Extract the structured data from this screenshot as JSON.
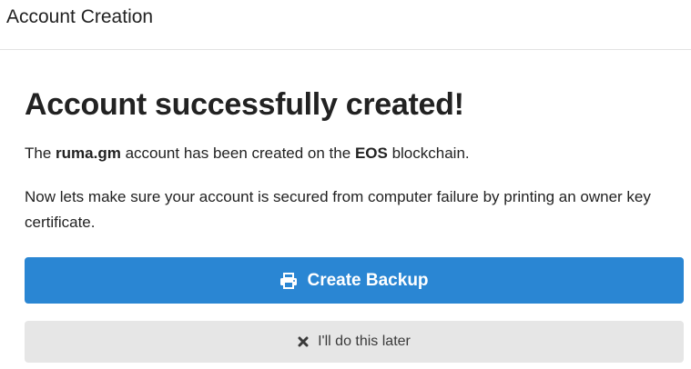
{
  "header": {
    "title": "Account Creation"
  },
  "main": {
    "headline": "Account successfully created!",
    "message": {
      "prefix": "The",
      "account_name": "ruma.gm",
      "middle": "account has been created on the",
      "chain": "EOS",
      "suffix": "blockchain."
    },
    "advice": "Now lets make sure your account is secured from computer failure by printing an owner key certificate."
  },
  "buttons": {
    "create_backup": {
      "label": "Create Backup",
      "icon": "printer-icon",
      "color": "#2a86d3"
    },
    "later": {
      "label": "I'll do this later",
      "icon": "close-icon",
      "color": "#e6e6e6"
    }
  }
}
